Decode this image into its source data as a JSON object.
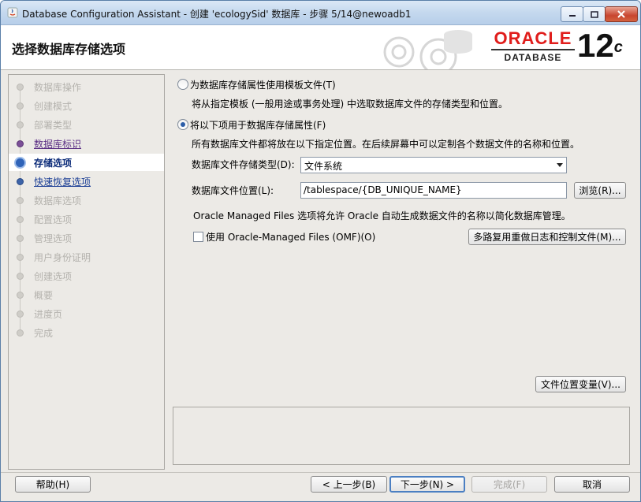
{
  "window": {
    "title": "Database Configuration Assistant - 创建 'ecologySid' 数据库 - 步骤 5/14@newoadb1"
  },
  "header": {
    "page_title": "选择数据库存储选项",
    "brand": "ORACLE",
    "brand_sub": "DATABASE",
    "version": "12",
    "version_suffix": "c",
    "brand_color": "#e01d1b"
  },
  "sidebar": {
    "steps": [
      {
        "label": "数据库操作",
        "state": "disabled"
      },
      {
        "label": "创建模式",
        "state": "disabled"
      },
      {
        "label": "部署类型",
        "state": "disabled"
      },
      {
        "label": "数据库标识",
        "state": "done"
      },
      {
        "label": "存储选项",
        "state": "current"
      },
      {
        "label": "快速恢复选项",
        "state": "link"
      },
      {
        "label": "数据库选项",
        "state": "disabled"
      },
      {
        "label": "配置选项",
        "state": "disabled"
      },
      {
        "label": "管理选项",
        "state": "disabled"
      },
      {
        "label": "用户身份证明",
        "state": "disabled"
      },
      {
        "label": "创建选项",
        "state": "disabled"
      },
      {
        "label": "概要",
        "state": "disabled"
      },
      {
        "label": "进度页",
        "state": "disabled"
      },
      {
        "label": "完成",
        "state": "disabled"
      }
    ]
  },
  "storage": {
    "option_template_label": "为数据库存储属性使用模板文件(T)",
    "option_template_desc": "将从指定模板 (一般用途或事务处理) 中选取数据库文件的存储类型和位置。",
    "option_custom_label": "将以下项用于数据库存储属性(F)",
    "option_custom_desc": "所有数据库文件都将放在以下指定位置。在后续屏幕中可以定制各个数据文件的名称和位置。",
    "selected_option": "custom",
    "type_label": "数据库文件存储类型(D):",
    "type_value": "文件系统",
    "location_label": "数据库文件位置(L):",
    "location_value": "/tablespace/{DB_UNIQUE_NAME}",
    "browse_button": "浏览(R)...",
    "omf_info": "Oracle Managed Files 选项将允许 Oracle 自动生成数据文件的名称以简化数据库管理。",
    "omf_checkbox_label": "使用 Oracle-Managed Files (OMF)(O)",
    "omf_checked": false,
    "multiplex_button": "多路复用重做日志和控制文件(M)...",
    "file_location_vars_button": "文件位置变量(V)..."
  },
  "footer": {
    "help": "帮助(H)",
    "back": "< 上一步(B)",
    "next": "下一步(N) >",
    "finish": "完成(F)",
    "cancel": "取消"
  }
}
